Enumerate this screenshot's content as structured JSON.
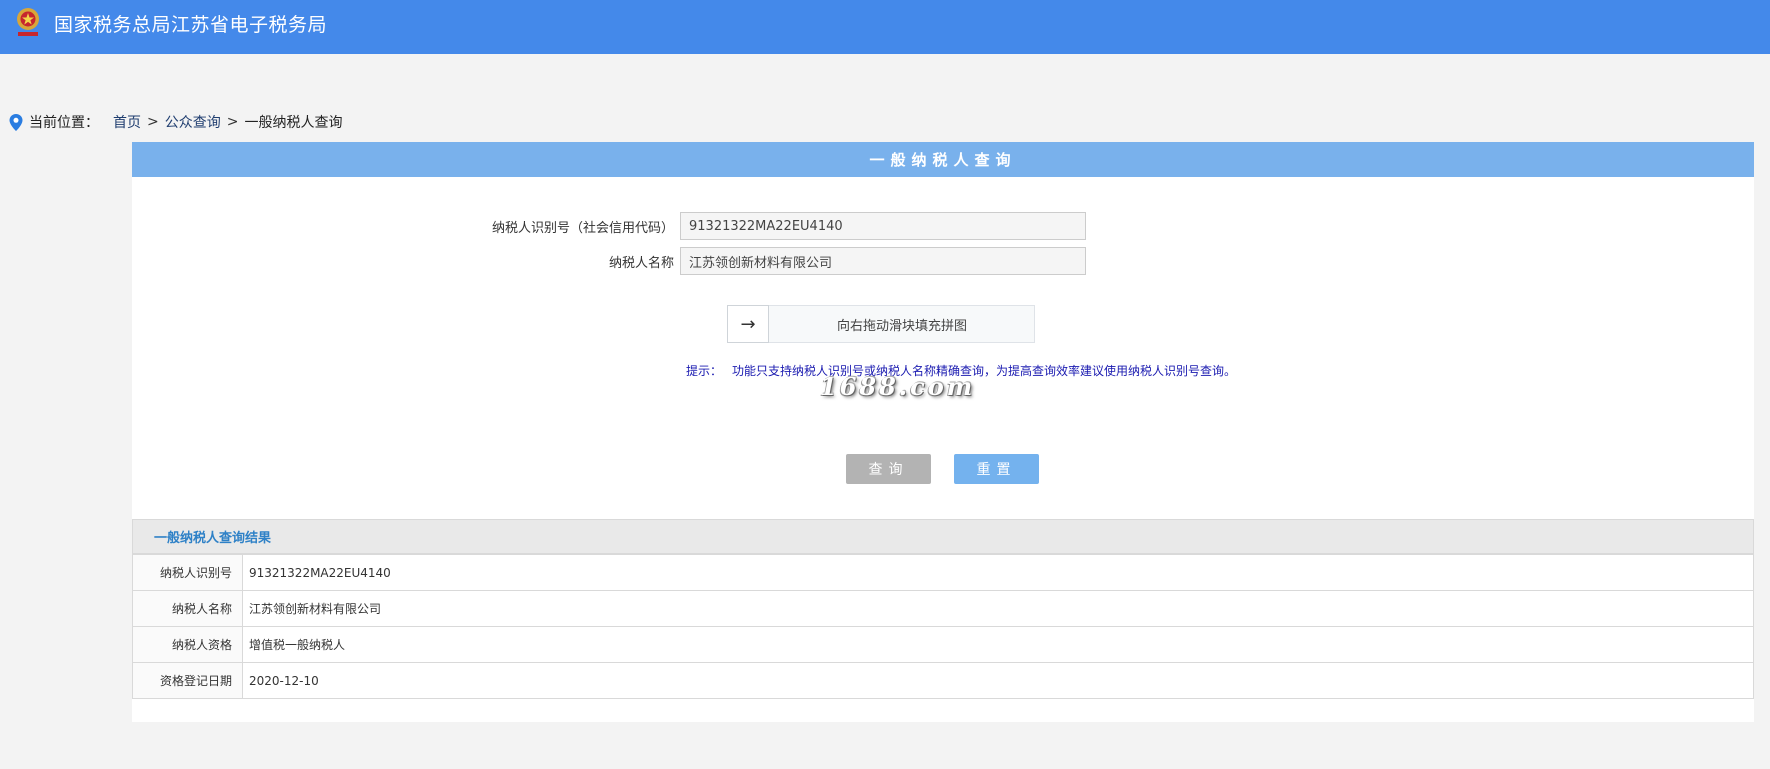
{
  "header": {
    "site_title": "国家税务总局江苏省电子税务局",
    "logo_icon": "tax-emblem-icon",
    "background_color": "#4489ea"
  },
  "breadcrumb": {
    "label": "当前位置：",
    "items": [
      "首页",
      "公众查询",
      "一般纳税人查询"
    ],
    "separator": ">"
  },
  "panel": {
    "title": "一般纳税人查询"
  },
  "form": {
    "taxpayer_id_label": "纳税人识别号（社会信用代码）",
    "taxpayer_id_value": "91321322MA22EU4140",
    "taxpayer_name_label": "纳税人名称",
    "taxpayer_name_value": "江苏领创新材料有限公司"
  },
  "slider": {
    "handle_icon": "arrow-right-icon",
    "handle_glyph": "→",
    "text": "向右拖动滑块填充拼图"
  },
  "tip": {
    "label": "提示：",
    "text": "功能只支持纳税人识别号或纳税人名称精确查询，为提高查询效率建议使用纳税人识别号查询。"
  },
  "watermark": "1688.com",
  "buttons": {
    "query": "查询",
    "reset": "重置"
  },
  "result": {
    "title": "一般纳税人查询结果",
    "rows": [
      {
        "key": "纳税人识别号",
        "value": "91321322MA22EU4140"
      },
      {
        "key": "纳税人名称",
        "value": "江苏领创新材料有限公司"
      },
      {
        "key": "纳税人资格",
        "value": "增值税一般纳税人"
      },
      {
        "key": "资格登记日期",
        "value": "2020-12-10"
      }
    ]
  }
}
